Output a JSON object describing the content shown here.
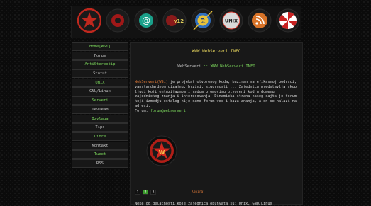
{
  "header": {
    "icons": [
      {
        "name": "red-star-icon",
        "color": "#c0281e"
      },
      {
        "name": "gear-icon",
        "color": "#a01818"
      },
      {
        "name": "at-sign-icon",
        "glyph": "@",
        "color": "#1aa08a"
      },
      {
        "name": "v12-icon",
        "label": "v12",
        "color": "#8a1a1a"
      },
      {
        "name": "compass-z-icon",
        "glyph": "Z",
        "color": "#2f6fc0"
      },
      {
        "name": "unix-icon",
        "label": "UNIX",
        "color": "#d43a30"
      },
      {
        "name": "rss-feed-icon",
        "color": "#d87328"
      },
      {
        "name": "umbrella-logo-icon",
        "color": "#c82222"
      }
    ]
  },
  "nav": {
    "items": [
      {
        "label": "Home[WSi]",
        "style": "main"
      },
      {
        "label": "Forum",
        "style": "sub"
      },
      {
        "label": "AntiStereotip",
        "style": "main"
      },
      {
        "label": "Statut",
        "style": "sub"
      },
      {
        "label": "UNIX",
        "style": "main"
      },
      {
        "label": "GNU/Linux",
        "style": "sub"
      },
      {
        "label": "Serveri",
        "style": "main"
      },
      {
        "label": "DevTeam",
        "style": "sub"
      },
      {
        "label": "Izvlaga",
        "style": "main"
      },
      {
        "label": "Tips",
        "style": "sub"
      },
      {
        "label": "Libre",
        "style": "main"
      },
      {
        "label": "Kontakt",
        "style": "sub"
      },
      {
        "label": "Tweet",
        "style": "main"
      },
      {
        "label": "RSS",
        "style": "sub"
      }
    ]
  },
  "main": {
    "title": "WWW.WebServeri.INFO",
    "subtitle_prefix": "WebServeri",
    "subtitle_sep": "::",
    "subtitle_url": "WWW.WebServeri.INFO",
    "desc_highlight": "WebServeri(WSi)",
    "desc_body": " je projekat otvorenog koda, baziran na efikasnoj podrsci, vanstandardnom dizajnu, brzini, sigurnosti ... Zajednica predstavlja skup ljudi koji entuzijazmom i radom promovisu otvoreni kod u domenu zajednickog znanja i interesovanja. Dinamicka strana naseg sajta je forum koji izmedju ostalog nije samo forum vec i baza znanja, a on se nalazi na adresi:",
    "forum_label": "Forum:",
    "forum_link": "forum@webserveri",
    "pager": [
      "1",
      "2",
      "3"
    ],
    "pager_active_index": 1,
    "pager_label": "Kopiraj",
    "bottom_text": "Neke od delatnosti koje zajednica obuhvata su: Unix, GNU/Linux"
  }
}
